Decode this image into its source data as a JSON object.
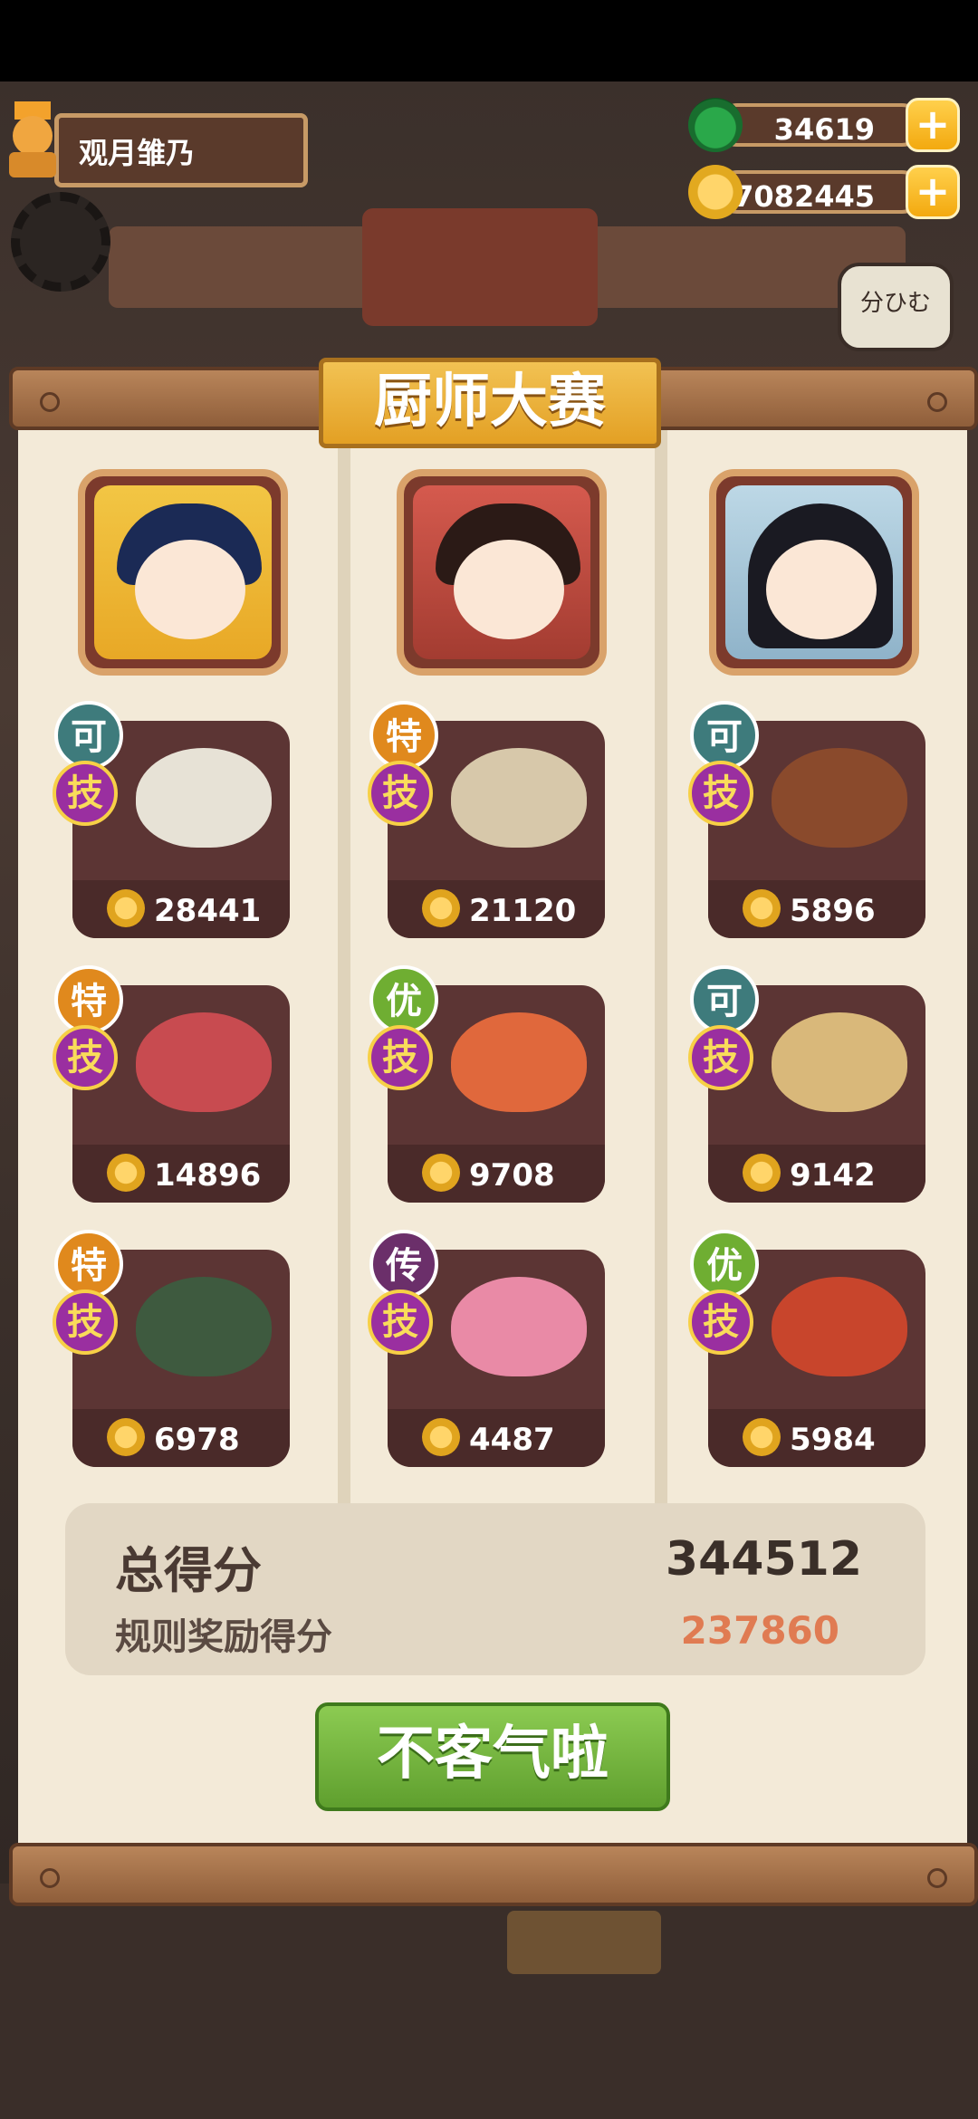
{
  "player": {
    "name": "观月雏乃"
  },
  "currency": {
    "jade": "34619",
    "coins": "17082445",
    "add_symbol": "+"
  },
  "bubble": {
    "text": "分ひむ"
  },
  "title": "厨师大赛",
  "chefs": [
    {
      "dishes": [
        {
          "rank": "可",
          "skill": "技",
          "price": "28441"
        },
        {
          "rank": "特",
          "skill": "技",
          "price": "14896"
        },
        {
          "rank": "特",
          "skill": "技",
          "price": "6978"
        }
      ]
    },
    {
      "dishes": [
        {
          "rank": "特",
          "skill": "技",
          "price": "21120"
        },
        {
          "rank": "优",
          "skill": "技",
          "price": "9708"
        },
        {
          "rank": "传",
          "skill": "技",
          "price": "4487"
        }
      ]
    },
    {
      "dishes": [
        {
          "rank": "可",
          "skill": "技",
          "price": "5896"
        },
        {
          "rank": "可",
          "skill": "技",
          "price": "9142"
        },
        {
          "rank": "优",
          "skill": "技",
          "price": "5984"
        }
      ]
    }
  ],
  "score": {
    "total_label": "总得分",
    "total_value": "344512",
    "bonus_label": "规则奖励得分",
    "bonus_value": "237860"
  },
  "confirm_button": "不客气啦",
  "colors": {
    "panel": "#f3ead8",
    "bonus": "#e07b52",
    "button": "#6fb23a",
    "title_plate": "#e9ad33"
  }
}
